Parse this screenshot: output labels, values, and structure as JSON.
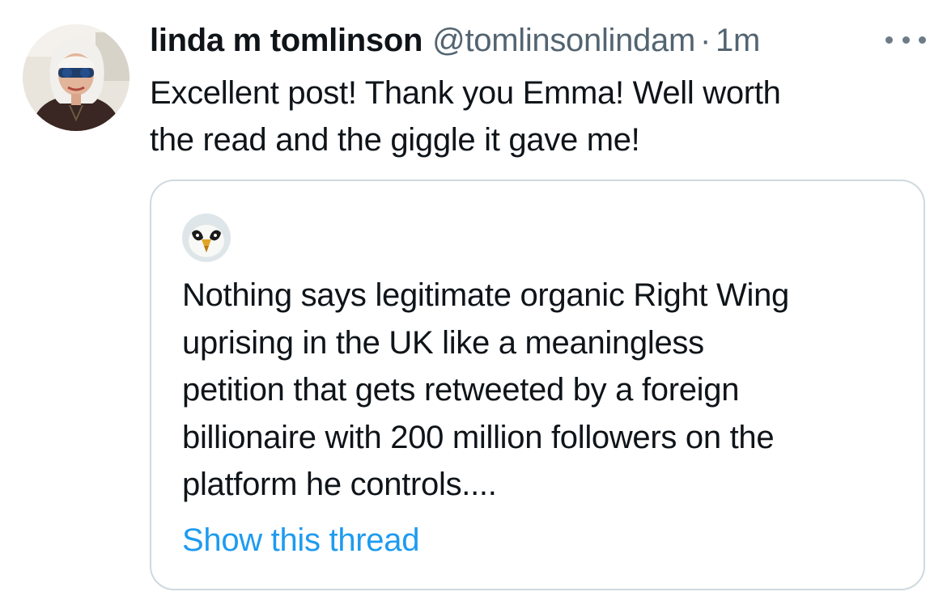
{
  "tweet": {
    "display_name": "linda m tomlinson",
    "handle": "@tomlinsonlindam",
    "separator": "·",
    "time": "1m",
    "lines": [
      "Excellent post! Thank you Emma! Well worth",
      "the read and the giggle it gave me!"
    ],
    "more_icon": "more-horizontal-icon",
    "avatar_icon": "profile-photo"
  },
  "quote": {
    "avatar_icon": "bird-profile-photo",
    "lines": [
      "Nothing says legitimate organic Right Wing",
      "uprising in the UK like a meaningless",
      "petition that gets retweeted by a foreign",
      "billionaire with 200 million followers on the",
      "platform he controls...."
    ],
    "show_thread": "Show this thread"
  },
  "colors": {
    "text": "#0f1419",
    "secondary": "#536471",
    "link": "#1d9bf0",
    "border": "#cfd9de"
  }
}
